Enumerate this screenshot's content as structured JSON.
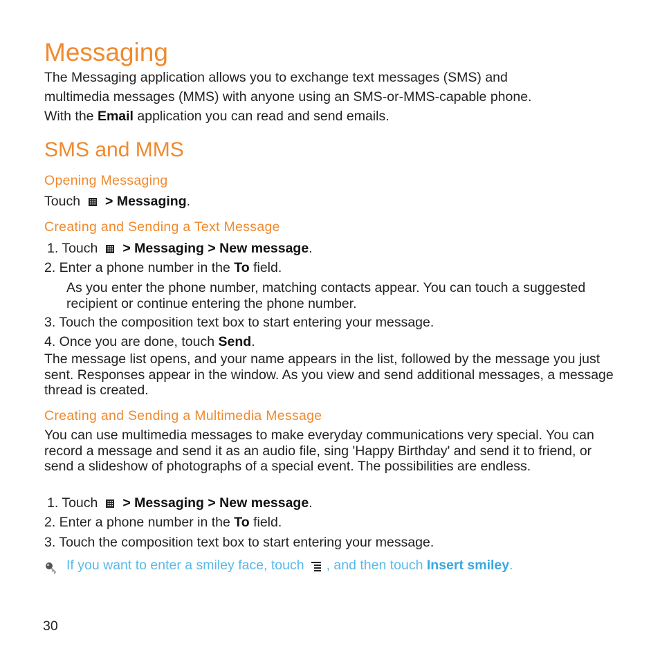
{
  "title": "Messaging",
  "intro": {
    "line1": "The Messaging application allows you to exchange text messages (SMS) and",
    "line2": "multimedia messages (MMS) with anyone using an SMS-or-MMS-capable phone.",
    "line3_pre": "With the ",
    "line3_bold": "Email",
    "line3_post": " application you can read and send emails."
  },
  "section": "SMS and MMS",
  "opening": {
    "heading": "Opening Messaging",
    "touch": "Touch",
    "path": "> Messaging",
    "end": "."
  },
  "text_msg": {
    "heading": "Creating and Sending a Text Message",
    "step1_pre": "1. Touch",
    "step1_path": "> Messaging > New message",
    "step2_pre": "2. Enter a phone number in the ",
    "step2_bold": "To",
    "step2_post": " field.",
    "step2_note": "As you enter the phone number, matching contacts appear. You can touch a suggested recipient or continue entering the phone number.",
    "step3": "3. Touch the composition text box to start entering your message.",
    "step4_pre": "4. Once you are done, touch ",
    "step4_bold": "Send",
    "after": "The message list opens, and your name appears in the list, followed by the message you just sent. Responses appear in the window. As you view and send additional messages, a message thread is created."
  },
  "mms": {
    "heading": "Creating and Sending a Multimedia Message",
    "body": "You can use multimedia messages to make everyday communications very special. You can record a message and send it as an audio file, sing 'Happy Birthday' and send it to friend, or send a slideshow of photographs of a special event. The possibilities are endless.",
    "step1_pre": "1. Touch",
    "step1_path": "> Messaging > New message",
    "step2_pre": "2. Enter a phone number in the ",
    "step2_bold": "To",
    "step2_post": " field.",
    "step3": "3. Touch the composition text box to start entering your message."
  },
  "tip": {
    "pre": "If you want to enter a smiley face, touch",
    "mid": ", and then touch ",
    "bold": "Insert smiley",
    "end": "."
  },
  "page_number": "30",
  "colors": {
    "heading": "#f08a2e",
    "tip": "#5ab8e8"
  }
}
